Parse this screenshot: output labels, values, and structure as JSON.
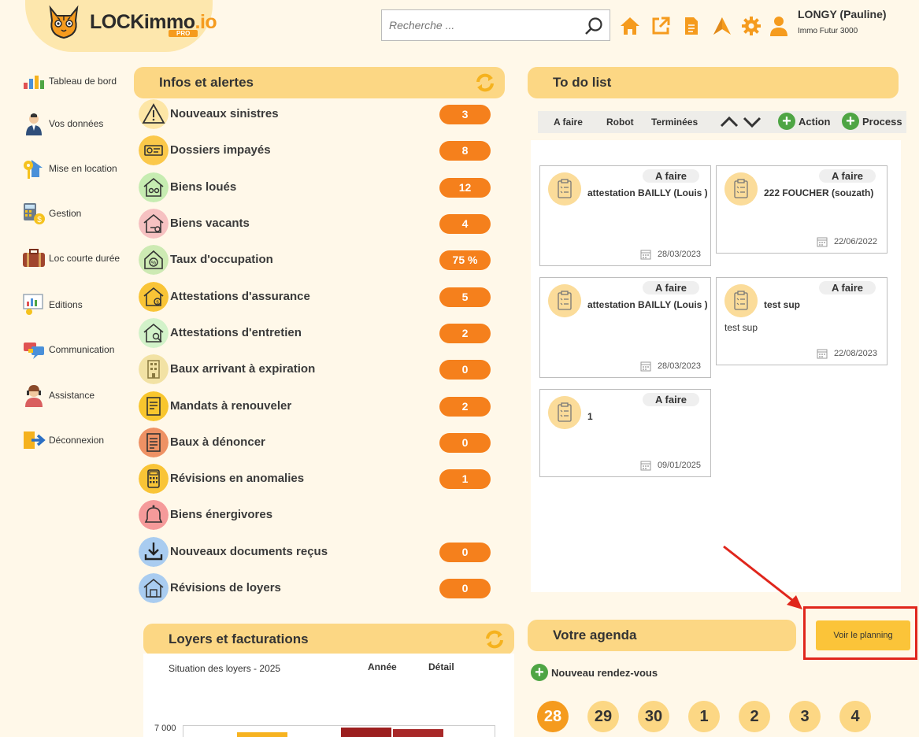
{
  "header": {
    "logo_text_main": "LOCKimmo",
    "logo_text_suffix": ".io",
    "logo_badge": "PRO",
    "search_placeholder": "Recherche ...",
    "user_name": "LONGY (Pauline)",
    "user_agency": "Immo Futur 3000"
  },
  "sidebar": {
    "items": [
      {
        "label": "Tableau de bord",
        "icon": "dashboard-icon"
      },
      {
        "label": "Vos données",
        "icon": "user-icon"
      },
      {
        "label": "Mise en location",
        "icon": "key-house-icon"
      },
      {
        "label": "Gestion",
        "icon": "calculator-icon"
      },
      {
        "label": "Loc courte durée",
        "icon": "suitcase-icon"
      },
      {
        "label": "Editions",
        "icon": "report-icon"
      },
      {
        "label": "Communication",
        "icon": "chat-icon"
      },
      {
        "label": "Assistance",
        "icon": "headset-icon"
      },
      {
        "label": "Déconnexion",
        "icon": "logout-icon"
      }
    ]
  },
  "infos": {
    "title": "Infos et alertes",
    "rows": [
      {
        "label": "Nouveaux sinistres",
        "count": "3",
        "color": "#fde6a6"
      },
      {
        "label": "Dossiers impayés",
        "count": "8",
        "color": "#fbc84a"
      },
      {
        "label": "Biens loués",
        "count": "12",
        "color": "#c6ecb1"
      },
      {
        "label": "Biens vacants",
        "count": "4",
        "color": "#f6c1c1"
      },
      {
        "label": "Taux d'occupation",
        "count": "75 %",
        "color": "#cdeab3"
      },
      {
        "label": "Attestations d'assurance",
        "count": "5",
        "color": "#f9c436"
      },
      {
        "label": "Attestations d'entretien",
        "count": "2",
        "color": "#d2f2c9"
      },
      {
        "label": "Baux arrivant à expiration",
        "count": "0",
        "color": "#f2e2a4"
      },
      {
        "label": "Mandats à renouveler",
        "count": "2",
        "color": "#f8c62e"
      },
      {
        "label": "Baux à dénoncer",
        "count": "0",
        "color": "#ee9164"
      },
      {
        "label": "Révisions en anomalies",
        "count": "1",
        "color": "#f9c436"
      },
      {
        "label": "Biens énergivores",
        "count": "",
        "color": "#f59a9a"
      },
      {
        "label": "Nouveaux documents reçus",
        "count": "0",
        "color": "#a9ccf0"
      },
      {
        "label": "Révisions de loyers",
        "count": "0",
        "color": "#a9ccf0"
      }
    ]
  },
  "todo": {
    "title": "To do list",
    "tabs": [
      "A faire",
      "Robot",
      "Terminées"
    ],
    "add_action": "Action",
    "add_process": "Process",
    "cards": [
      {
        "status": "A faire",
        "title": "attestation BAILLY (Louis )",
        "desc": "",
        "date": "28/03/2023"
      },
      {
        "status": "A faire",
        "title": "222 FOUCHER (souzath)",
        "desc": "",
        "date": "22/06/2022"
      },
      {
        "status": "A faire",
        "title": "attestation BAILLY (Louis )",
        "desc": "",
        "date": "28/03/2023"
      },
      {
        "status": "A faire",
        "title": "test sup",
        "desc": "test sup",
        "date": "22/08/2023"
      },
      {
        "status": "A faire",
        "title": "1",
        "desc": "",
        "date": "09/01/2025"
      }
    ]
  },
  "loyers": {
    "title": "Loyers et facturations",
    "subtitle": "Situation des loyers - 2025",
    "col_year": "Année",
    "col_detail": "Détail",
    "y_tick_top": "7 000"
  },
  "agenda": {
    "title": "Votre agenda",
    "planning_button": "Voir le planning",
    "new_rdv": "Nouveau rendez-vous",
    "days": [
      "28",
      "29",
      "30",
      "1",
      "2",
      "3",
      "4"
    ]
  },
  "colors": {
    "accent": "#f59b1e",
    "panel_header": "#fcd784",
    "count_badge": "#f5801c",
    "add_green": "#4ea544",
    "annotation_red": "#e0261c"
  }
}
